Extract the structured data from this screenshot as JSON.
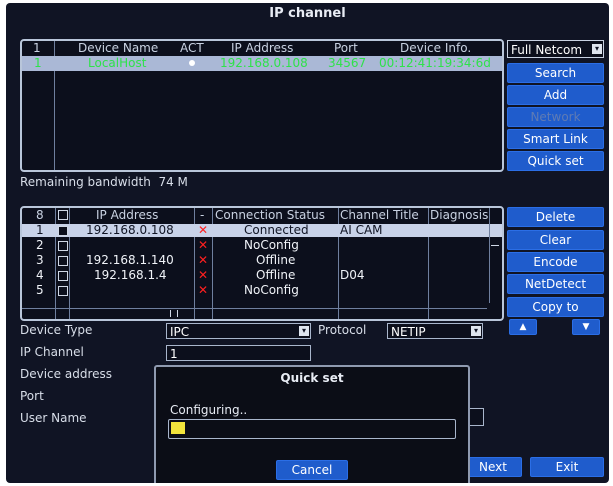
{
  "window": {
    "title": "IP channel"
  },
  "device_list": {
    "headers": [
      "1",
      "Device Name",
      "ACT",
      "IP Address",
      "Port",
      "Device Info."
    ],
    "rows": [
      {
        "index": "1",
        "name": "LocalHost",
        "ip": "192.168.0.108",
        "port": "34567",
        "info": "00:12:41:19:34:6d"
      }
    ]
  },
  "search_panel": {
    "filter_value": "Full Netcom",
    "buttons": [
      "Search",
      "Add",
      "Network",
      "Smart Link",
      "Quick set"
    ]
  },
  "bandwidth": {
    "label": "Remaining bandwidth",
    "value": "74 M"
  },
  "channel_list": {
    "headers": [
      "8",
      "IP Address",
      "-",
      "Connection Status",
      "Channel Title",
      "Diagnosis"
    ],
    "rows": [
      {
        "index": "1",
        "ip": "192.168.0.108",
        "status": "Connected",
        "title": "AI CAM"
      },
      {
        "index": "2",
        "ip": "",
        "status": "NoConfig",
        "title": ""
      },
      {
        "index": "3",
        "ip": "192.168.1.140",
        "status": "Offline",
        "title": ""
      },
      {
        "index": "4",
        "ip": "192.168.1.4",
        "status": "Offline",
        "title": "D04"
      },
      {
        "index": "5",
        "ip": "",
        "status": "NoConfig",
        "title": ""
      }
    ]
  },
  "channel_buttons": [
    "Delete",
    "Clear",
    "Encode",
    "NetDetect",
    "Copy to"
  ],
  "form": {
    "device_type_label": "Device Type",
    "device_type_value": "IPC",
    "protocol_label": "Protocol",
    "protocol_value": "NETIP",
    "ip_channel_label": "IP Channel",
    "ip_channel_value": "1",
    "device_address_label": "Device address",
    "port_label": "Port",
    "user_name_label": "User Name"
  },
  "footer": {
    "next_label": "Next",
    "exit_label": "Exit"
  },
  "dialog": {
    "title": "Quick set",
    "status_text": "Configuring..",
    "progress": 0.05,
    "cancel_label": "Cancel"
  },
  "colors": {
    "accent": "#1f5ccc",
    "selected_text": "#2ee24a",
    "progress": "#f2e43c",
    "error": "#ff2020"
  }
}
